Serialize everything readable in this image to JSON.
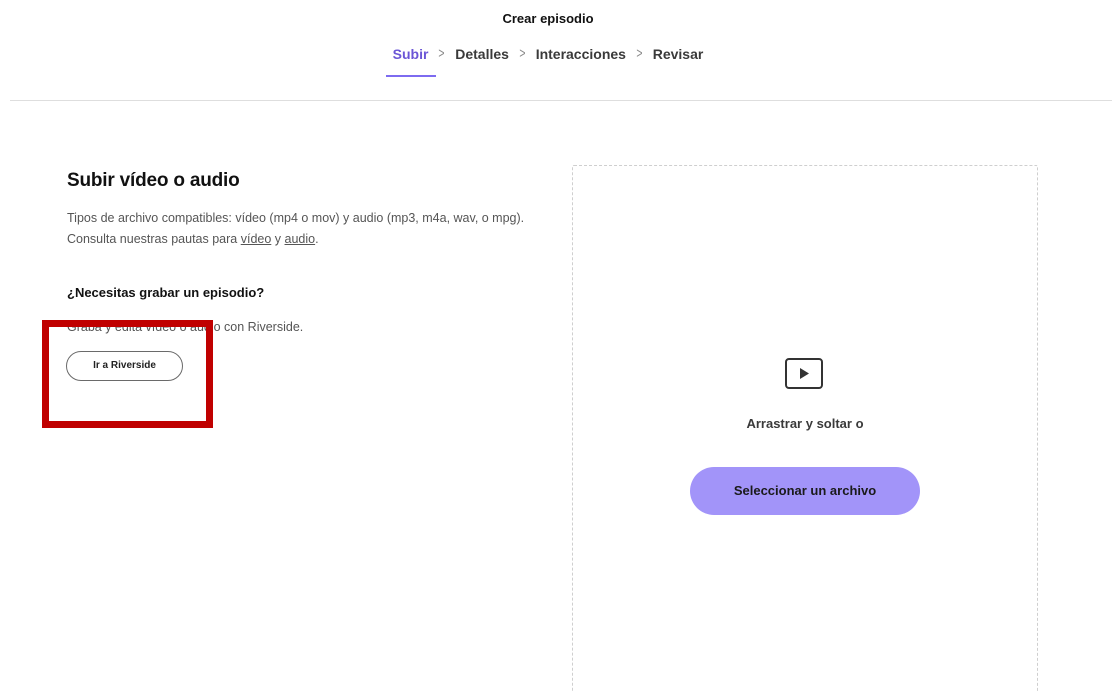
{
  "header": {
    "title": "Crear episodio",
    "steps": [
      {
        "label": "Subir",
        "active": true
      },
      {
        "label": "Detalles",
        "active": false
      },
      {
        "label": "Interacciones",
        "active": false
      },
      {
        "label": "Revisar",
        "active": false
      }
    ]
  },
  "upload": {
    "title": "Subir vídeo o audio",
    "description_prefix": "Tipos de archivo compatibles: vídeo (mp4 o mov) y audio (mp3, m4a, wav, o mpg). Consulta nuestras pautas para ",
    "link_video": "vídeo",
    "conjunction": " y ",
    "link_audio": "audio",
    "description_suffix": "."
  },
  "record": {
    "heading": "¿Necesitas grabar un episodio?",
    "text": "Graba y edita vídeo o audio con Riverside.",
    "button_label": "Ir a Riverside"
  },
  "dropzone": {
    "icon": "video-play-icon",
    "text": "Arrastrar y soltar o",
    "button_label": "Seleccionar un archivo"
  },
  "colors": {
    "accent": "#7d6bf0",
    "button_fill": "#a294f9",
    "highlight": "#c00000"
  }
}
